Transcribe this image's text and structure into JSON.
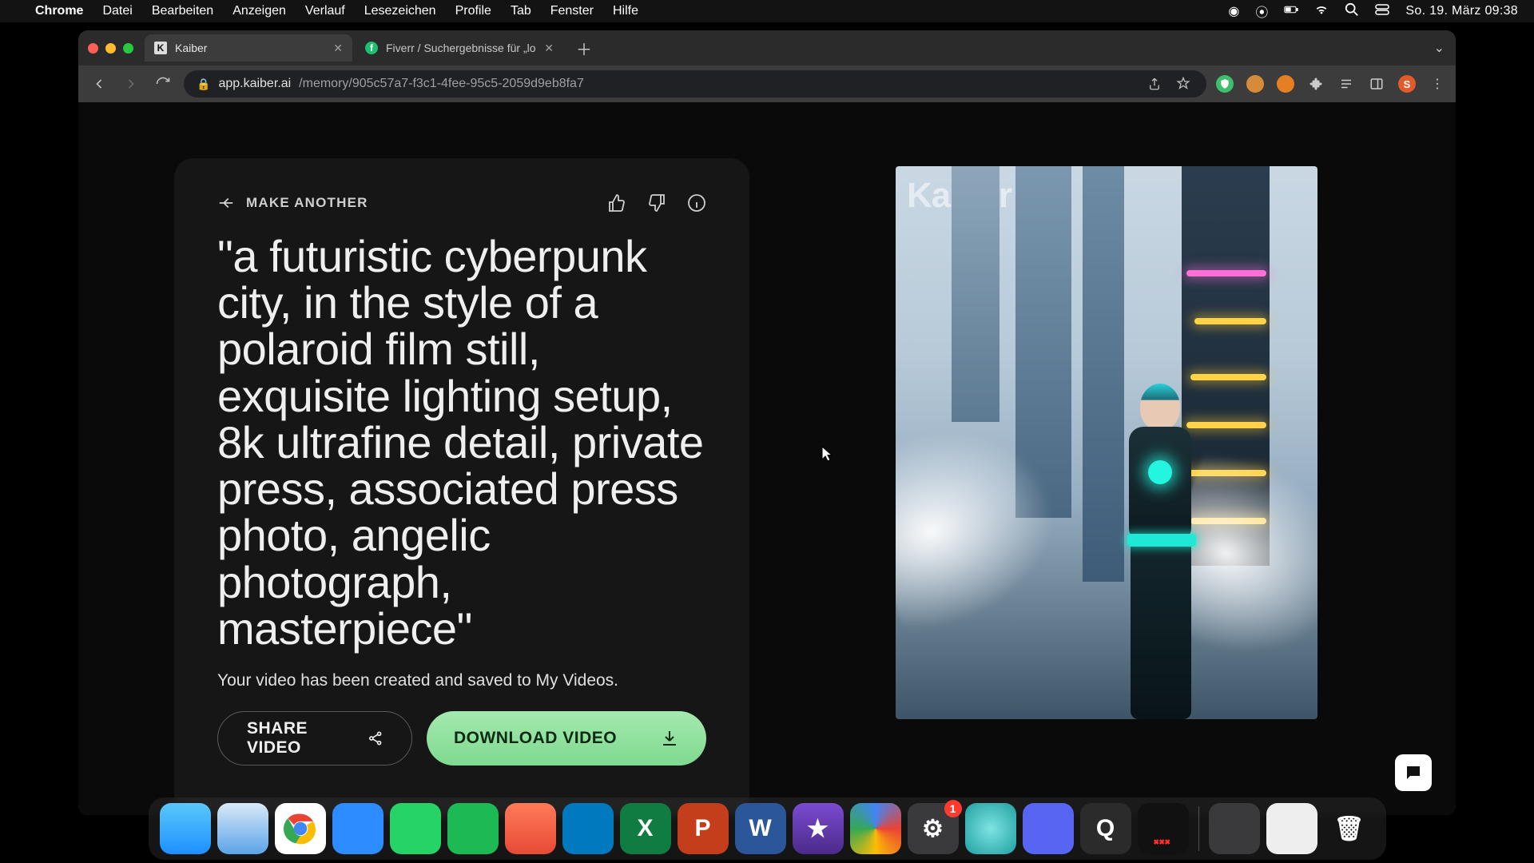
{
  "menubar": {
    "app_name": "Chrome",
    "items": [
      "Datei",
      "Bearbeiten",
      "Anzeigen",
      "Verlauf",
      "Lesezeichen",
      "Profile",
      "Tab",
      "Fenster",
      "Hilfe"
    ],
    "clock": "So. 19. März  09:38"
  },
  "tabs": {
    "active": {
      "title": "Kaiber",
      "favicon": "K"
    },
    "inactive": {
      "title": "Fiverr / Suchergebnisse für „lo",
      "favicon": "f"
    }
  },
  "omnibox": {
    "host": "app.kaiber.ai",
    "path": "/memory/905c57a7-f3c1-4fee-95c5-2059d9eb8fa7"
  },
  "profile_letter": "S",
  "card": {
    "make_another": "MAKE ANOTHER",
    "prompt": "\"a futuristic cyberpunk city, in the style of a polaroid film still, exquisite lighting setup, 8k ultrafine detail, private press, associated press photo, angelic photograph, masterpiece\"",
    "status": "Your video has been created and saved to My Videos.",
    "share_label": "SHARE VIDEO",
    "download_label": "DOWNLOAD VIDEO"
  },
  "preview": {
    "watermark": "Kaiber"
  },
  "dock": {
    "settings_badge": "1"
  }
}
